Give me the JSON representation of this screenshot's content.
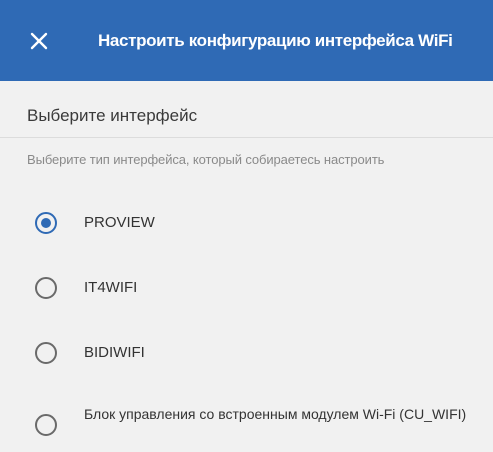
{
  "header": {
    "close_icon": "close-icon",
    "title": "Настроить конфигурацию интерфейса WiFi",
    "background_color": "#2f6ab5"
  },
  "section": {
    "title": "Выберите интерфейс",
    "hint": "Выберите тип интерфейса, который собираетесь настроить"
  },
  "options": [
    {
      "label": "PROVIEW",
      "selected": true
    },
    {
      "label": "IT4WIFI",
      "selected": false
    },
    {
      "label": "BIDIWIFI",
      "selected": false
    },
    {
      "label": "Блок управления со встроенным модулем Wi-Fi (CU_WIFI)",
      "selected": false
    }
  ],
  "colors": {
    "accent": "#2f6ab5",
    "background": "#f1f1f1"
  }
}
